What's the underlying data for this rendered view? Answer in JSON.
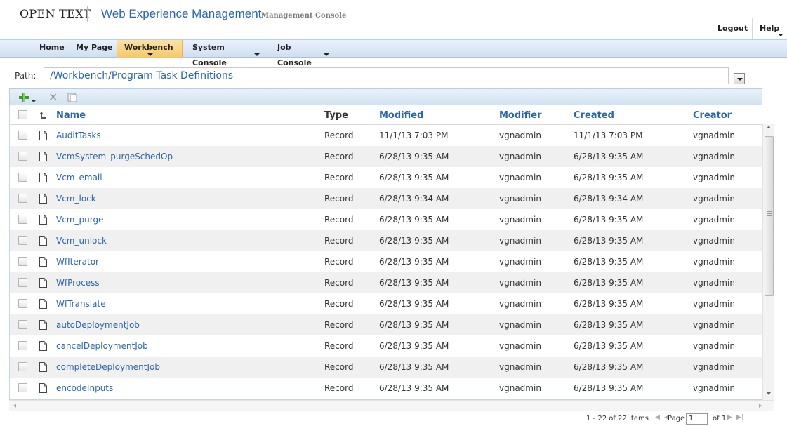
{
  "header": {
    "logo": "OPEN TEXT",
    "product": "Web Experience Management",
    "console": "Management Console",
    "logout": "Logout",
    "help": "Help"
  },
  "nav": [
    {
      "label": "Home",
      "active": false,
      "dropdown": false
    },
    {
      "label": "My Page",
      "active": false,
      "dropdown": false
    },
    {
      "label": "Workbench",
      "active": true,
      "dropdown": true
    },
    {
      "label": "System Console",
      "active": false,
      "dropdown": true
    },
    {
      "label": "Job Console",
      "active": false,
      "dropdown": true
    }
  ],
  "path": {
    "label": "Path:",
    "value": "/Workbench/Program Task Definitions"
  },
  "toolbar": {
    "add_icon": "add-icon",
    "delete_icon": "delete-icon",
    "copy_icon": "copy-icon"
  },
  "table": {
    "columns": {
      "name": "Name",
      "type": "Type",
      "modified": "Modified",
      "modifier": "Modifier",
      "created": "Created",
      "creator": "Creator"
    },
    "rows": [
      {
        "name": "AuditTasks",
        "type": "Record",
        "modified": "11/1/13 7:03 PM",
        "modifier": "vgnadmin",
        "created": "11/1/13 7:03 PM",
        "creator": "vgnadmin"
      },
      {
        "name": "VcmSystem_purgeSchedOp",
        "type": "Record",
        "modified": "6/28/13 9:35 AM",
        "modifier": "vgnadmin",
        "created": "6/28/13 9:35 AM",
        "creator": "vgnadmin"
      },
      {
        "name": "Vcm_email",
        "type": "Record",
        "modified": "6/28/13 9:35 AM",
        "modifier": "vgnadmin",
        "created": "6/28/13 9:35 AM",
        "creator": "vgnadmin"
      },
      {
        "name": "Vcm_lock",
        "type": "Record",
        "modified": "6/28/13 9:34 AM",
        "modifier": "vgnadmin",
        "created": "6/28/13 9:34 AM",
        "creator": "vgnadmin"
      },
      {
        "name": "Vcm_purge",
        "type": "Record",
        "modified": "6/28/13 9:35 AM",
        "modifier": "vgnadmin",
        "created": "6/28/13 9:35 AM",
        "creator": "vgnadmin"
      },
      {
        "name": "Vcm_unlock",
        "type": "Record",
        "modified": "6/28/13 9:35 AM",
        "modifier": "vgnadmin",
        "created": "6/28/13 9:35 AM",
        "creator": "vgnadmin"
      },
      {
        "name": "WfIterator",
        "type": "Record",
        "modified": "6/28/13 9:35 AM",
        "modifier": "vgnadmin",
        "created": "6/28/13 9:35 AM",
        "creator": "vgnadmin"
      },
      {
        "name": "WfProcess",
        "type": "Record",
        "modified": "6/28/13 9:35 AM",
        "modifier": "vgnadmin",
        "created": "6/28/13 9:35 AM",
        "creator": "vgnadmin"
      },
      {
        "name": "WfTranslate",
        "type": "Record",
        "modified": "6/28/13 9:35 AM",
        "modifier": "vgnadmin",
        "created": "6/28/13 9:35 AM",
        "creator": "vgnadmin"
      },
      {
        "name": "autoDeploymentJob",
        "type": "Record",
        "modified": "6/28/13 9:35 AM",
        "modifier": "vgnadmin",
        "created": "6/28/13 9:35 AM",
        "creator": "vgnadmin"
      },
      {
        "name": "cancelDeploymentJob",
        "type": "Record",
        "modified": "6/28/13 9:35 AM",
        "modifier": "vgnadmin",
        "created": "6/28/13 9:35 AM",
        "creator": "vgnadmin"
      },
      {
        "name": "completeDeploymentJob",
        "type": "Record",
        "modified": "6/28/13 9:35 AM",
        "modifier": "vgnadmin",
        "created": "6/28/13 9:35 AM",
        "creator": "vgnadmin"
      },
      {
        "name": "encodeInputs",
        "type": "Record",
        "modified": "6/28/13 9:35 AM",
        "modifier": "vgnadmin",
        "created": "6/28/13 9:35 AM",
        "creator": "vgnadmin"
      }
    ]
  },
  "pager": {
    "summary": "1 - 22 of 22 Items",
    "page_label": "Page",
    "page_value": "1",
    "of_label": "of 1"
  },
  "colors": {
    "link": "#2b66a8",
    "active_tab": "#f6c86a",
    "nav_bg": "#cfe0f1",
    "row_alt": "#f0f0f0"
  }
}
